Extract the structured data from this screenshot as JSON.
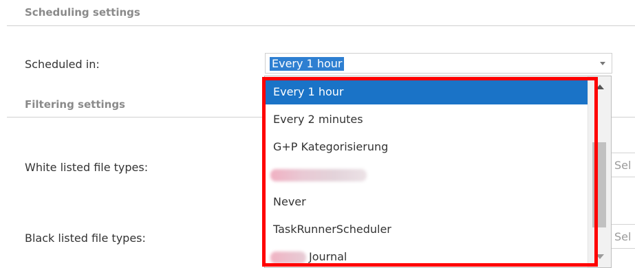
{
  "scheduling": {
    "section_title": "Scheduling settings",
    "scheduled_in_label": "Scheduled in:",
    "selected_value": "Every 1 hour"
  },
  "filtering": {
    "section_title": "Filtering settings",
    "white_label": "White listed file types:",
    "black_label": "Black listed file types:",
    "right_select_partial": "Sel"
  },
  "dropdown": {
    "options": [
      {
        "label": "Every 1 hour",
        "selected": true
      },
      {
        "label": "Every 2 minutes"
      },
      {
        "label": "G+P Kategorisierung"
      },
      {
        "label": "",
        "redacted": true
      },
      {
        "label": "Never"
      },
      {
        "label": "TaskRunnerScheduler"
      },
      {
        "label": "Journal",
        "partially_redacted": true
      }
    ]
  },
  "colors": {
    "selection": "#1a73c7",
    "highlight_border": "#ff0000"
  },
  "icons": {
    "caret": "chevron-down-icon",
    "scroll_up": "scroll-up-arrow-icon",
    "scroll_down": "scroll-down-arrow-icon"
  }
}
